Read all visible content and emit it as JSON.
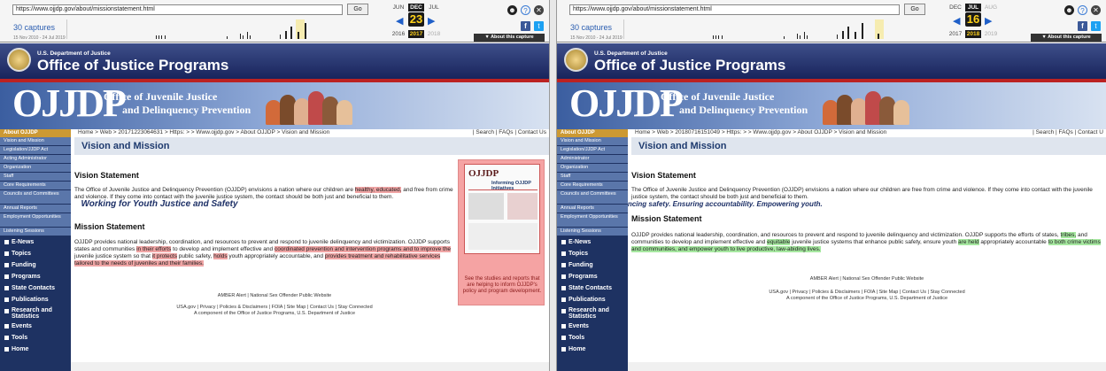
{
  "panels": [
    {
      "id": "A",
      "wayback": {
        "url": "https://www.ojjdp.gov/about/missionstatement.html",
        "go": "Go",
        "captures": "30 captures",
        "range": "15 Nov 2010 - 24 Jul 2019",
        "months": [
          "JUN",
          "DEC",
          "JUL"
        ],
        "day": "23",
        "years": [
          "2016",
          "2017",
          "2018"
        ],
        "about": "▼ About this capture"
      },
      "ojp": {
        "doj": "U.S. Department of Justice",
        "title": "Office of Justice Programs"
      },
      "banner": {
        "logo": "OJJDP",
        "line1": "Office of Juvenile Justice",
        "line2": "and Delinquency Prevention",
        "tagline": "Working for Youth Justice and Safety"
      },
      "nav": {
        "current": "About OJJDP",
        "subs": [
          "Vision and Mission",
          "Legislation/JJDP Act",
          "Acting Administrator",
          "Organization",
          "Staff",
          "Core Requirements",
          "Councils and Committees",
          "Annual Reports",
          "Employment Opportunities",
          "Listening Sessions"
        ],
        "mains": [
          "E-News",
          "Topics",
          "Funding",
          "Programs",
          "State Contacts",
          "Publications",
          "Research and Statistics",
          "Events",
          "Tools",
          "Home"
        ]
      },
      "breadcrumb": "Home > Web > 20171223064631 > Https: > > Www.ojjdp.gov > About OJJDP > Vision and Mission",
      "utils": "| Search | FAQs | Contact Us",
      "page_title": "Vision and Mission",
      "vision_heading": "Vision Statement",
      "vision": {
        "p1": "The Office of Juvenile Justice and Delinquency Prevention (OJJDP) envisions a nation where our children are ",
        "m1": "healthy, educated,",
        "p2": " and free from crime and violence. If they come into contact with the juvenile justice system, the contact should be both just and beneficial to them."
      },
      "mission_heading": "Mission Statement",
      "mission": {
        "p1": "OJJDP provides national leadership, coordination, and resources to prevent and respond to juvenile delinquency and victimization. OJJDP supports states and communities ",
        "m1": "in their efforts",
        "p2": " to develop and implement effective and ",
        "m2": "coordinated prevention and intervention programs and to improve the",
        "p3": " juvenile justice system so that ",
        "m3": "it protects",
        "p4": " public safety, ",
        "m4": "holds",
        "p5": " youth appropriately accountable, and ",
        "m5": "provides treatment and rehabilitative services tailored to the needs of juveniles and their families."
      },
      "footer": {
        "l1": "AMBER Alert | National Sex Offender Public Website",
        "l2": "USA.gov | Privacy | Policies & Disclaimers | FOIA | Site Map | Contact Us | Stay Connected",
        "l3": "A component of the Office of Justice Programs, U.S. Department of Justice"
      },
      "pub": {
        "cover_title": "Informing OJJDP Initiatives",
        "caption": "See the studies and reports that are helping to inform OJJDP's policy and program development."
      }
    },
    {
      "id": "B",
      "wayback": {
        "url": "https://www.ojjdp.gov/about/missionstatement.html",
        "go": "Go",
        "captures": "30 captures",
        "range": "15 Nov 2010 - 24 Jul 2019",
        "months": [
          "DEC",
          "JUL",
          "AUG"
        ],
        "day": "16",
        "years": [
          "2017",
          "2018",
          "2019"
        ],
        "about": "▼ About this capture"
      },
      "ojp": {
        "doj": "U.S. Department of Justice",
        "title": "Office of Justice Programs"
      },
      "banner": {
        "logo": "OJJDP",
        "line1": "Office of Juvenile Justice",
        "line2": "and Delinquency Prevention",
        "tagline": "Enhancing safety. Ensuring accountability. Empowering youth."
      },
      "nav": {
        "current": "About OJJDP",
        "subs": [
          "Vision and Mission",
          "Legislation/JJDP Act",
          "Administrator",
          "Organization",
          "Staff",
          "Core Requirements",
          "Councils and Committees",
          "Annual Reports",
          "Employment Opportunities",
          "Listening Sessions"
        ],
        "mains": [
          "E-News",
          "Topics",
          "Funding",
          "Programs",
          "State Contacts",
          "Publications",
          "Research and Statistics",
          "Events",
          "Tools",
          "Home"
        ]
      },
      "breadcrumb": "Home > Web > 20180716151049 > Https: > > Www.ojjdp.gov > About OJJDP > Vision and Mission",
      "utils": "| Search | FAQs | Contact U",
      "page_title": "Vision and Mission",
      "vision_heading": "Vision Statement",
      "vision": {
        "p1": "The Office of Juvenile Justice and Delinquency Prevention (OJJDP) envisions a nation where our children are free from crime and violence. If they come into contact with the juvenile justice system, the contact should be both just and beneficial to them.",
        "m1": "",
        "p2": ""
      },
      "mission_heading": "Mission Statement",
      "mission": {
        "p1": "OJJDP provides national leadership, coordination, and resources to prevent and respond to juvenile delinquency and victimization. OJJDP supports the efforts of states, ",
        "m1": "tribes,",
        "p2": " and communities to develop and implement effective and ",
        "m2": "equitable",
        "p3": " juvenile justice systems that enhance public safety, ensure youth ",
        "m3": "are held",
        "p4": " appropriately accountable ",
        "m4": "to both crime victims and communities, and empower youth to live productive, law-abiding lives.",
        "p5": "",
        "m5": ""
      },
      "footer": {
        "l1": "AMBER Alert | National Sex Offender Public Website",
        "l2": "USA.gov | Privacy | Policies & Disclaimers | FOIA | Site Map | Contact Us | Stay Connected",
        "l3": "A component of the Office of Justice Programs, U.S. Department of Justice"
      }
    }
  ]
}
